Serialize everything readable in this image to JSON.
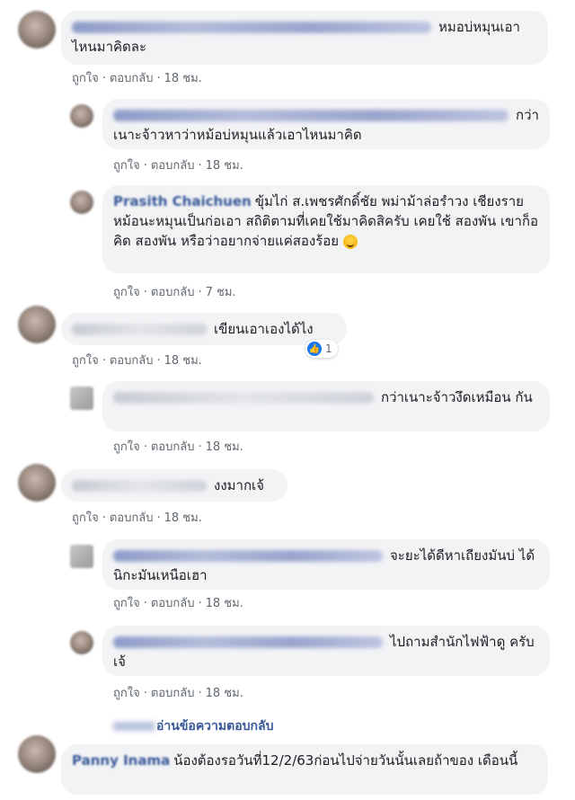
{
  "labels": {
    "like": "ถูกใจ",
    "reply": "ตอบกลับ",
    "separator": "·"
  },
  "comments": [
    {
      "name": "",
      "text": "หมอบ่หมุนเอา ไหนมาคิดละ",
      "time": "18 ชม."
    },
    {
      "name": "",
      "text": "กว่าเนาะจ้าวหาว่าหม้อบ่หมุนแล้วเอาไหนมาคิด",
      "time": "18 ชม."
    },
    {
      "name": "Prasith Chaichuen",
      "text": "ขุ้มไก่ ส.เพชรศักดิ์ชัย พม่าม้าล่อรำวง เชียงราย หม้อนะหมุนเป็นก่อเอา สถิติตามที่เคยใช้มาคิดสิครับ เคยใช้ สองพัน เขาก็อคิด สองพัน หรือว่าอยากจ่ายแค่สองร้อย",
      "time": "7 ชม."
    },
    {
      "name": "",
      "text": "เขียนเอาเองได้ไง",
      "time": "18 ชม.",
      "reactions": "1"
    },
    {
      "name": "",
      "text": "กว่าเนาะจ้าวงึดเหมือน กัน",
      "time": "18 ชม."
    },
    {
      "name": "",
      "text": "งงมากเจ้",
      "time": "18 ชม."
    },
    {
      "name": "",
      "text": "จะยะได้ดีหาเถียงมันบ่ ได้นิกะมันเหนือเฮา",
      "time": "18 ชม."
    },
    {
      "name": "",
      "text": "ไปถามสำนักไฟฟ้าดู ครับเจ้",
      "time": "18 ชม."
    },
    {
      "name": "Panny Inama",
      "text": "น้องต้องรอวันที่12/2/63ก่อนไปจ่ายวันนั้นเลยถ้าของ เดือนนี้"
    }
  ],
  "view_replies": "อ่านข้อความตอบกลับ"
}
